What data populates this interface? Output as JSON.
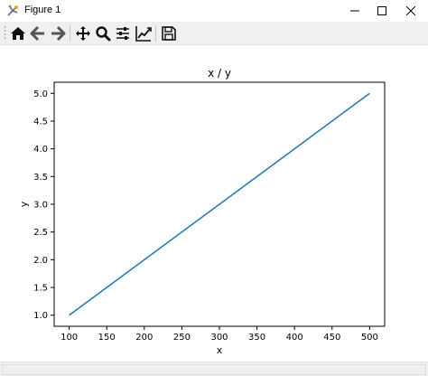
{
  "window": {
    "title": "Figure 1"
  },
  "toolbar": {
    "items": [
      {
        "icon": "home-icon"
      },
      {
        "icon": "back-arrow-icon"
      },
      {
        "icon": "forward-arrow-icon"
      },
      {
        "icon": "pan-move-icon"
      },
      {
        "icon": "zoom-magnifier-icon"
      },
      {
        "icon": "configure-subplots-icon"
      },
      {
        "icon": "edit-axis-curve-icon"
      },
      {
        "icon": "save-floppy-icon"
      }
    ]
  },
  "colors": {
    "line": "#1f77b4",
    "toolbar_bg": "#f0f0f0",
    "axes_edge": "#000000"
  },
  "chart_data": {
    "type": "line",
    "title": "x / y",
    "xlabel": "x",
    "ylabel": "y",
    "xlim": [
      80,
      520
    ],
    "ylim": [
      0.8,
      5.2
    ],
    "x_ticks": [
      100,
      150,
      200,
      250,
      300,
      350,
      400,
      450,
      500
    ],
    "y_ticks": [
      1.0,
      1.5,
      2.0,
      2.5,
      3.0,
      3.5,
      4.0,
      4.5,
      5.0
    ],
    "x_tick_labels": [
      "100",
      "150",
      "200",
      "250",
      "300",
      "350",
      "400",
      "450",
      "500"
    ],
    "y_tick_labels": [
      "1.0",
      "1.5",
      "2.0",
      "2.5",
      "3.0",
      "3.5",
      "4.0",
      "4.5",
      "5.0"
    ],
    "grid": false,
    "series": [
      {
        "x": [
          100,
          500
        ],
        "values": [
          1.0,
          5.0
        ]
      }
    ]
  }
}
